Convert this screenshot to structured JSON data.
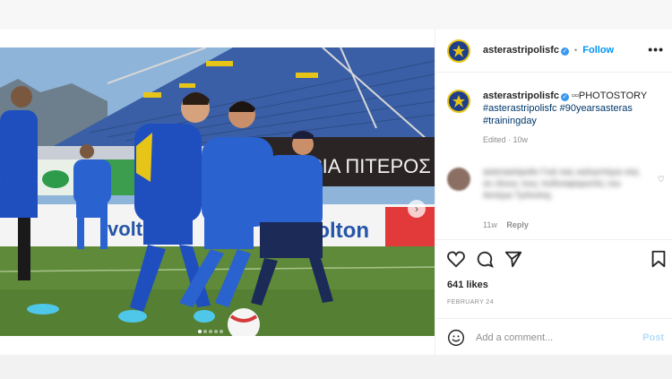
{
  "header": {
    "username": "asterastripolisfc",
    "separator": "•",
    "follow_label": "Follow",
    "more_label": "•••"
  },
  "caption": {
    "username": "asterastripolisfc",
    "text": "PHOTOSTORY",
    "hashtags": "#asterastripolisfc #90yearsasteras #trainingday",
    "meta": "Edited · 10w"
  },
  "comment": {
    "text": "asterastripolis Γειά σας καλησπέρα σας σε όλους τους ποδοσφαιριστές του Αστέρα Τρίπολης",
    "time": "11w",
    "reply_label": "Reply"
  },
  "image": {
    "banner_text_1": "ΡΙΑ ΠΙΤΕΡΟΣ",
    "banner_text_2": "volton",
    "banner_text_3": "volton"
  },
  "actions": {
    "like_icon": "heart-icon",
    "comment_icon": "comment-icon",
    "share_icon": "share-icon",
    "save_icon": "bookmark-icon"
  },
  "likes": "641 likes",
  "date": "FEBRUARY 24",
  "add_comment": {
    "emoji_icon": "emoji-icon",
    "placeholder": "Add a comment...",
    "post_label": "Post"
  },
  "colors": {
    "accent": "#0095f6",
    "kit_blue": "#1f4fbf",
    "kit_yellow": "#e6c518"
  }
}
